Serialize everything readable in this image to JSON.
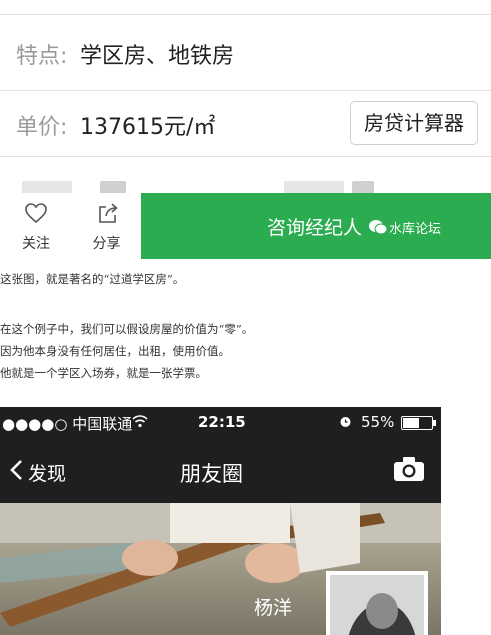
{
  "listing": {
    "feature_label": "特点:",
    "feature_value": "学区房、地铁房",
    "price_label": "单价:",
    "price_value": "137615元/㎡",
    "loan_button": "房贷计算器"
  },
  "actions": {
    "follow": "关注",
    "share": "分享",
    "consult": "咨询经纪人"
  },
  "watermark": "水库论坛",
  "article": {
    "line1": "这张图，就是著名的“过道学区房”。",
    "line2": "在这个例子中，我们可以假设房屋的价值为“零”。",
    "line3": "因为他本身没有任何居住，出租，使用价值。",
    "line4": "他就是一个学区入场券，就是一张学票。"
  },
  "phone": {
    "carrier": "●●●●○ 中国联通",
    "time": "22:15",
    "battery": "55%",
    "back_label": "发现",
    "title": "朋友圈",
    "user_name": "杨洋"
  },
  "colors": {
    "green": "#2bac51"
  }
}
